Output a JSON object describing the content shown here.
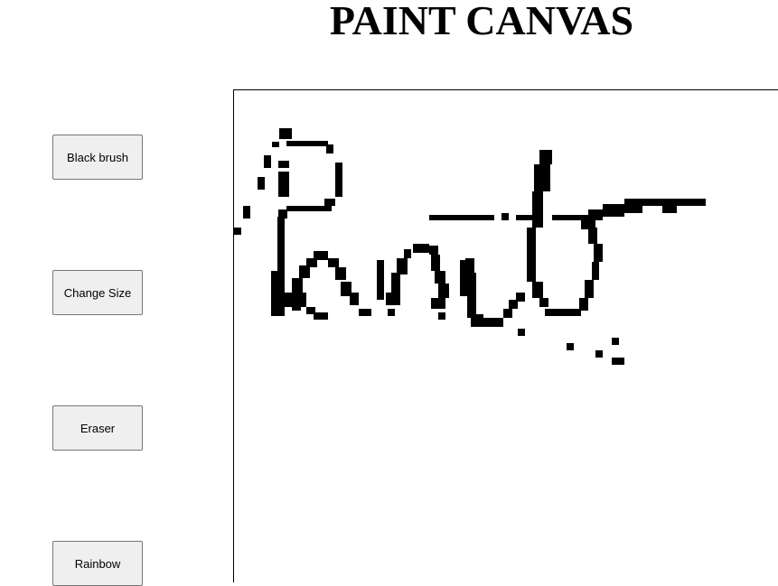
{
  "page": {
    "title": "PAINT CANVAS"
  },
  "tools": [
    {
      "id": "black-brush",
      "label": "Black brush"
    },
    {
      "id": "change-size",
      "label": "Change Size"
    },
    {
      "id": "eraser",
      "label": "Eraser"
    },
    {
      "id": "rainbow",
      "label": "Rainbow"
    }
  ],
  "canvas": {
    "background": "#ffffff",
    "ink_color": "#000000"
  }
}
